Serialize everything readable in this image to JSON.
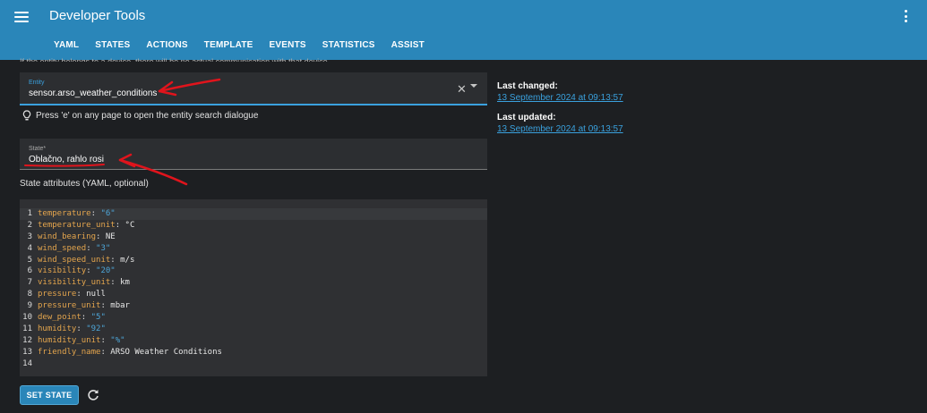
{
  "app": {
    "title": "Developer Tools"
  },
  "header": {
    "menu_icon": "menu-icon",
    "more_icon": "more-vert-icon"
  },
  "tabs": [
    {
      "label": "YAML",
      "active": false
    },
    {
      "label": "STATES",
      "active": true
    },
    {
      "label": "ACTIONS",
      "active": false
    },
    {
      "label": "TEMPLATE",
      "active": false
    },
    {
      "label": "EVENTS",
      "active": false
    },
    {
      "label": "STATISTICS",
      "active": false
    },
    {
      "label": "ASSIST",
      "active": false
    }
  ],
  "intro_text": "If the entity belongs to a device, there will be no actual communication with that device.",
  "entity": {
    "label": "Entity",
    "value": "sensor.arso_weather_conditions",
    "clear_icon": "close-icon",
    "dropdown_icon": "chevron-down-icon"
  },
  "hint": {
    "icon": "lightbulb-icon",
    "text": "Press 'e' on any page to open the entity search dialogue"
  },
  "state": {
    "label": "State*",
    "value": "Oblačno, rahlo rosi"
  },
  "attributes": {
    "label": "State attributes (YAML, optional)",
    "lines": [
      {
        "n": "1",
        "key": "temperature",
        "value": "\"6\"",
        "quoted": true
      },
      {
        "n": "2",
        "key": "temperature_unit",
        "value": "°C",
        "quoted": false
      },
      {
        "n": "3",
        "key": "wind_bearing",
        "value": "NE",
        "quoted": false
      },
      {
        "n": "4",
        "key": "wind_speed",
        "value": "\"3\"",
        "quoted": true
      },
      {
        "n": "5",
        "key": "wind_speed_unit",
        "value": "m/s",
        "quoted": false
      },
      {
        "n": "6",
        "key": "visibility",
        "value": "\"20\"",
        "quoted": true
      },
      {
        "n": "7",
        "key": "visibility_unit",
        "value": "km",
        "quoted": false
      },
      {
        "n": "8",
        "key": "pressure",
        "value": "null",
        "quoted": false
      },
      {
        "n": "9",
        "key": "pressure_unit",
        "value": "mbar",
        "quoted": false
      },
      {
        "n": "10",
        "key": "dew_point",
        "value": "\"5\"",
        "quoted": true
      },
      {
        "n": "11",
        "key": "humidity",
        "value": "\"92\"",
        "quoted": true
      },
      {
        "n": "12",
        "key": "humidity_unit",
        "value": "\"%\"",
        "quoted": true
      },
      {
        "n": "13",
        "key": "friendly_name",
        "value": "ARSO Weather Conditions",
        "quoted": false
      },
      {
        "n": "14",
        "key": "",
        "value": "",
        "quoted": false
      }
    ]
  },
  "side": {
    "last_changed_label": "Last changed:",
    "last_changed_value": "13 September 2024 at 09:13:57",
    "last_updated_label": "Last updated:",
    "last_updated_value": "13 September 2024 at 09:13:57"
  },
  "actions": {
    "set_state_label": "SET STATE",
    "refresh_icon": "refresh-icon"
  },
  "colors": {
    "header": "#2a86b9",
    "background": "#1d1f22",
    "accent": "#3aa1de",
    "annotation": "#e0141c"
  }
}
